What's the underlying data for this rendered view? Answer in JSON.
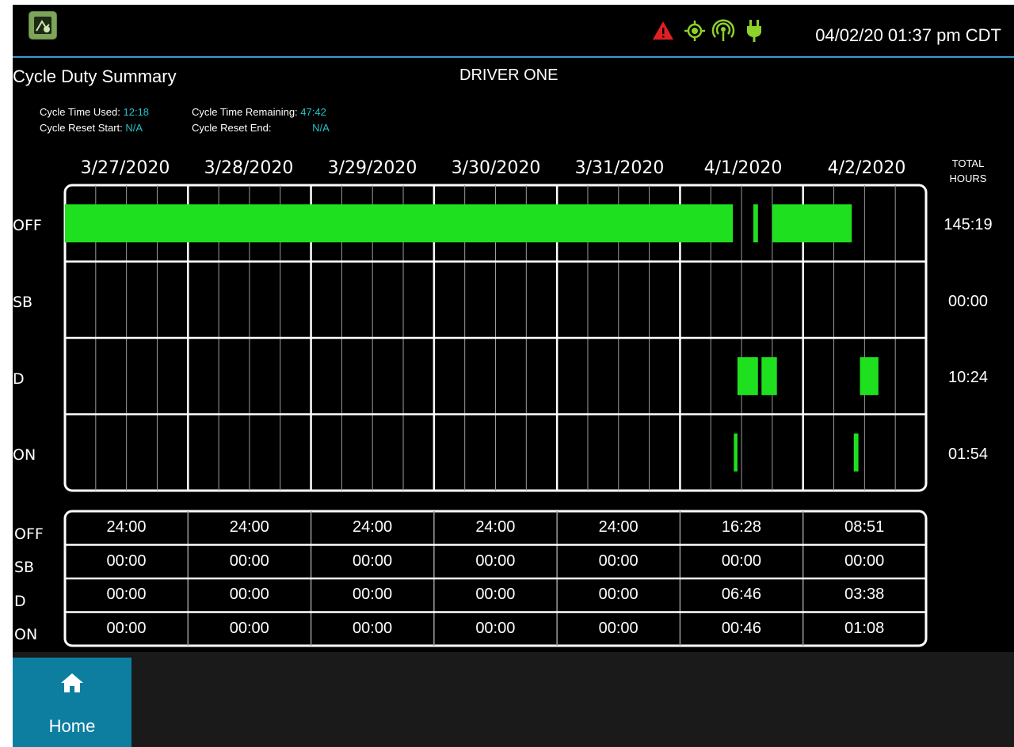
{
  "status_bar": {
    "datetime": "04/02/20 01:37 pm CDT",
    "icons": [
      "app-icon",
      "alert-icon",
      "gps-icon",
      "signal-icon",
      "power-plug-icon"
    ],
    "alert_color": "#e02020",
    "ok_color": "#8ed12a"
  },
  "header": {
    "title": "Cycle Duty Summary",
    "driver": "DRIVER ONE"
  },
  "cycle_info": {
    "time_used_label": "Cycle Time Used:",
    "time_used_value": "12:18",
    "time_remaining_label": "Cycle Time Remaining:",
    "time_remaining_value": "47:42",
    "reset_start_label": "Cycle Reset Start:",
    "reset_start_value": "N/A",
    "reset_end_label": "Cycle Reset End:",
    "reset_end_value": "N/A"
  },
  "graph": {
    "dates": [
      "3/27/2020",
      "3/28/2020",
      "3/29/2020",
      "3/30/2020",
      "3/31/2020",
      "4/1/2020",
      "4/2/2020"
    ],
    "total_header_line1": "TOTAL",
    "total_header_line2": "HOURS",
    "statuses": [
      "OFF",
      "SB",
      "D",
      "ON"
    ],
    "totals": [
      "145:19",
      "00:00",
      "10:24",
      "01:54"
    ],
    "segments_hours_from_start": [
      {
        "status": "OFF",
        "start": 0,
        "end": 130.3
      },
      {
        "status": "OFF",
        "start": 134.3,
        "end": 135.2
      },
      {
        "status": "OFF",
        "start": 138.0,
        "end": 153.5
      },
      {
        "status": "D",
        "start": 131.2,
        "end": 135.2
      },
      {
        "status": "D",
        "start": 135.9,
        "end": 138.9
      },
      {
        "status": "D",
        "start": 155.1,
        "end": 158.7
      },
      {
        "status": "ON",
        "start": 130.5,
        "end": 131.2
      },
      {
        "status": "ON",
        "start": 153.9,
        "end": 154.8
      }
    ],
    "bar_color": "#1fe01f"
  },
  "summary": {
    "rows": [
      {
        "label": "OFF",
        "values": [
          "24:00",
          "24:00",
          "24:00",
          "24:00",
          "24:00",
          "16:28",
          "08:51"
        ]
      },
      {
        "label": "SB",
        "values": [
          "00:00",
          "00:00",
          "00:00",
          "00:00",
          "00:00",
          "00:00",
          "00:00"
        ]
      },
      {
        "label": "D",
        "values": [
          "00:00",
          "00:00",
          "00:00",
          "00:00",
          "00:00",
          "06:46",
          "03:38"
        ]
      },
      {
        "label": "ON",
        "values": [
          "00:00",
          "00:00",
          "00:00",
          "00:00",
          "00:00",
          "00:46",
          "01:08"
        ]
      }
    ]
  },
  "nav": {
    "home_label": "Home"
  }
}
